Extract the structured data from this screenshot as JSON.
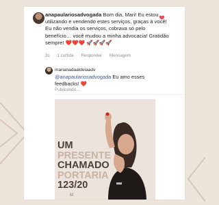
{
  "comment": {
    "username": "anapaulariosadvogada",
    "text": " Bom dia, Mari! Eu estou utilizando  e vendendo estes serviços, graças à você! Eu não  vendia os serviços, cobrava só  pelo benefício… você  mudou a minha advocacia! Gratidão  sempre! ❤️❤️❤️ 🚀🚀🚀🚀",
    "time": "3s",
    "likes": "1 curtida",
    "reply_label": "Responder",
    "message_label": "Mensagem",
    "heart_color": "#ed4956"
  },
  "reply": {
    "username": "marianadaaldeiaadv",
    "mention": "@anapaulariosadvogada",
    "text": " Eu amo esses feedbacks! ❤️",
    "status": "Publicando..."
  },
  "post": {
    "line1": "UM",
    "line2": "PRESENTE",
    "line3": "CHAMADO",
    "line4": "PORTARIA",
    "line5": "123/20",
    "logo": "M",
    "accent_color": "#c9b2a0",
    "dark_color": "#4a3f3a"
  }
}
